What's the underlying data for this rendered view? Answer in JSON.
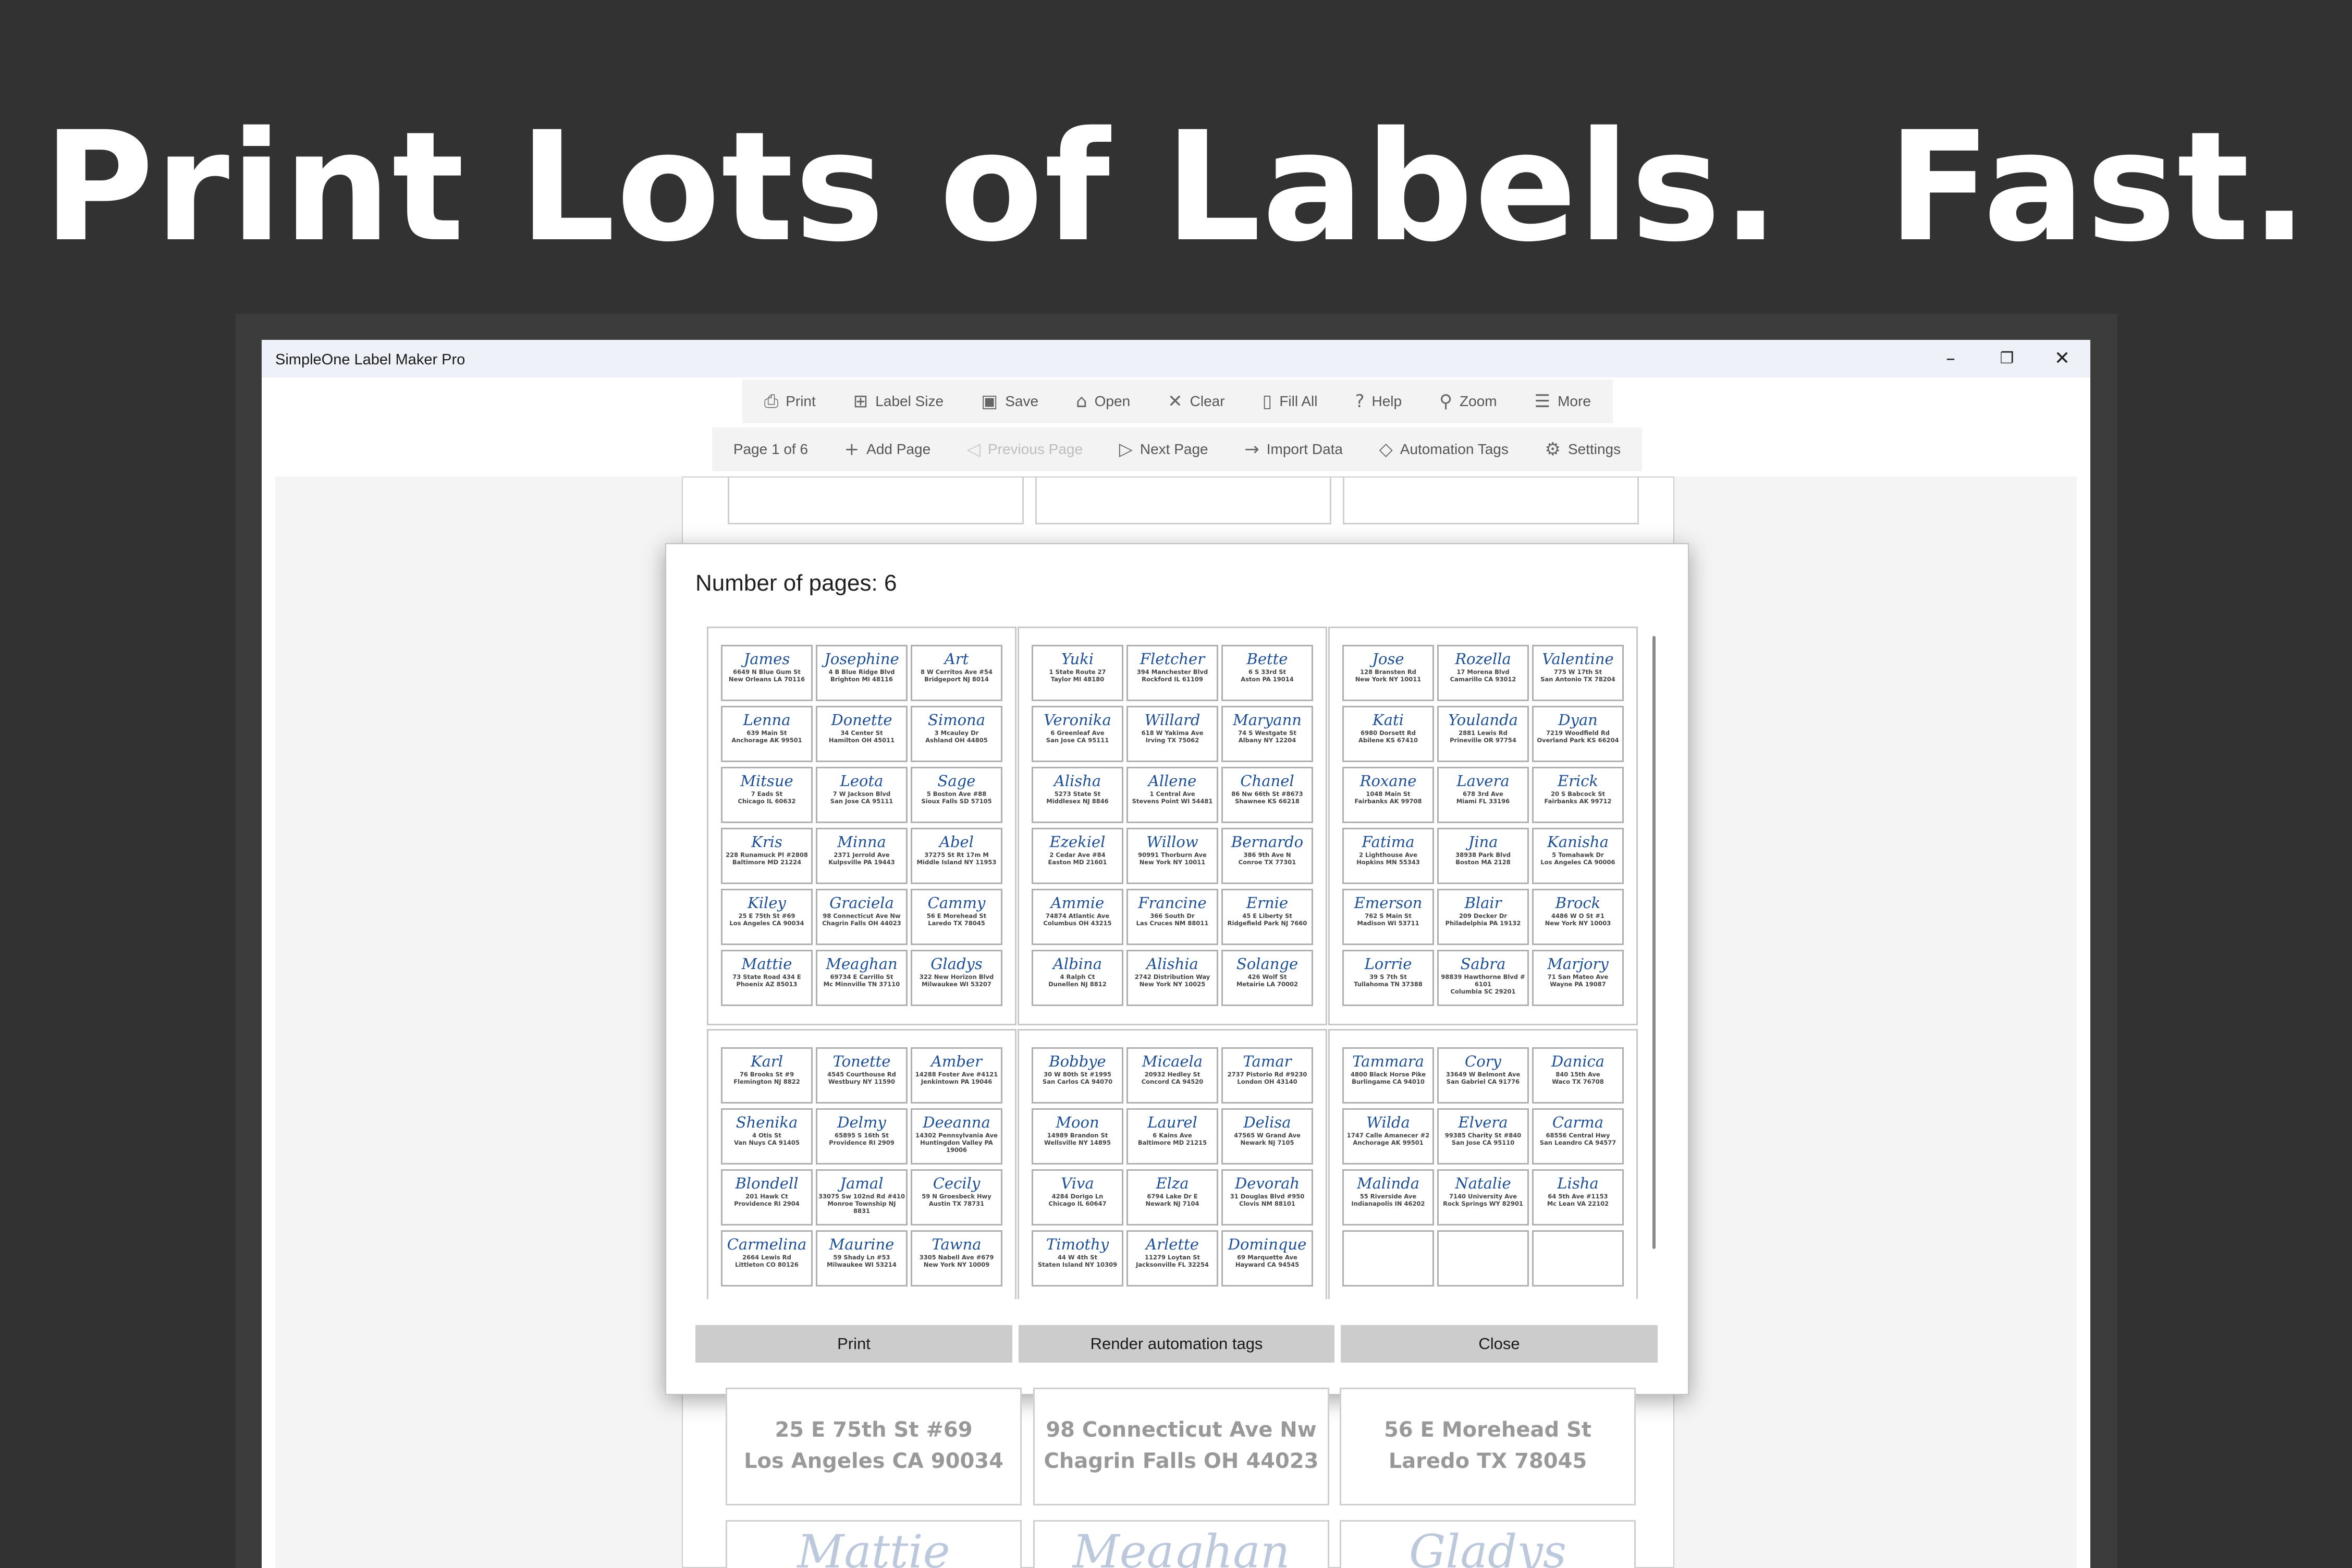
{
  "headline": "Print Lots of Labels.  Fast.",
  "window": {
    "title": "SimpleOne Label Maker Pro",
    "minimize": "–",
    "restore": "❐",
    "close": "✕"
  },
  "toolbar_main": [
    {
      "name": "print",
      "label": "Print",
      "icon": "⎙"
    },
    {
      "name": "label-size",
      "label": "Label Size",
      "icon": "⊞"
    },
    {
      "name": "save",
      "label": "Save",
      "icon": "▣"
    },
    {
      "name": "open",
      "label": "Open",
      "icon": "⌂"
    },
    {
      "name": "clear",
      "label": "Clear",
      "icon": "✕"
    },
    {
      "name": "fill-all",
      "label": "Fill All",
      "icon": "▯"
    },
    {
      "name": "help",
      "label": "Help",
      "icon": "?"
    },
    {
      "name": "zoom",
      "label": "Zoom",
      "icon": "⚲"
    },
    {
      "name": "more",
      "label": "More",
      "icon": "☰"
    }
  ],
  "toolbar_page": [
    {
      "name": "page-indicator",
      "label": "Page 1 of 6",
      "icon": "",
      "disabled": false
    },
    {
      "name": "add-page",
      "label": "Add Page",
      "icon": "+",
      "disabled": false
    },
    {
      "name": "previous-page",
      "label": "Previous Page",
      "icon": "◁",
      "disabled": true
    },
    {
      "name": "next-page",
      "label": "Next Page",
      "icon": "▷",
      "disabled": false
    },
    {
      "name": "import-data",
      "label": "Import Data",
      "icon": "→",
      "disabled": false
    },
    {
      "name": "automation-tags",
      "label": "Automation Tags",
      "icon": "◇",
      "disabled": false
    },
    {
      "name": "settings",
      "label": "Settings",
      "icon": "⚙",
      "disabled": false
    }
  ],
  "background_labels": [
    {
      "line1": "25 E 75th St #69",
      "line2": "Los Angeles CA 90034",
      "name": "Mattie"
    },
    {
      "line1": "98 Connecticut Ave Nw",
      "line2": "Chagrin Falls OH 44023",
      "name": "Meaghan"
    },
    {
      "line1": "56 E Morehead St",
      "line2": "Laredo TX 78045",
      "name": "Gladys"
    }
  ],
  "dialog": {
    "title": "Number of pages: 6",
    "buttons": {
      "print": "Print",
      "render": "Render automation tags",
      "close": "Close"
    },
    "pages": [
      {
        "labels": [
          [
            "James",
            "6649 N Blue Gum St",
            "New Orleans LA 70116"
          ],
          [
            "Josephine",
            "4 B Blue Ridge Blvd",
            "Brighton MI 48116"
          ],
          [
            "Art",
            "8 W Cerritos Ave #54",
            "Bridgeport NJ 8014"
          ],
          [
            "Lenna",
            "639 Main St",
            "Anchorage AK 99501"
          ],
          [
            "Donette",
            "34 Center St",
            "Hamilton OH 45011"
          ],
          [
            "Simona",
            "3 Mcauley Dr",
            "Ashland OH 44805"
          ],
          [
            "Mitsue",
            "7 Eads St",
            "Chicago IL 60632"
          ],
          [
            "Leota",
            "7 W Jackson Blvd",
            "San Jose CA 95111"
          ],
          [
            "Sage",
            "5 Boston Ave #88",
            "Sioux Falls SD 57105"
          ],
          [
            "Kris",
            "228 Runamuck Pl #2808",
            "Baltimore MD 21224"
          ],
          [
            "Minna",
            "2371 Jerrold Ave",
            "Kulpsville PA 19443"
          ],
          [
            "Abel",
            "37275 St  Rt 17m M",
            "Middle Island NY 11953"
          ],
          [
            "Kiley",
            "25 E 75th St #69",
            "Los Angeles CA 90034"
          ],
          [
            "Graciela",
            "98 Connecticut Ave Nw",
            "Chagrin Falls OH 44023"
          ],
          [
            "Cammy",
            "56 E Morehead St",
            "Laredo TX 78045"
          ],
          [
            "Mattie",
            "73 State Road 434 E",
            "Phoenix AZ 85013"
          ],
          [
            "Meaghan",
            "69734 E Carrillo St",
            "Mc Minnville TN 37110"
          ],
          [
            "Gladys",
            "322 New Horizon Blvd",
            "Milwaukee WI 53207"
          ]
        ]
      },
      {
        "labels": [
          [
            "Yuki",
            "1 State Route 27",
            "Taylor MI 48180"
          ],
          [
            "Fletcher",
            "394 Manchester Blvd",
            "Rockford IL 61109"
          ],
          [
            "Bette",
            "6 S 33rd St",
            "Aston PA 19014"
          ],
          [
            "Veronika",
            "6 Greenleaf Ave",
            "San Jose CA 95111"
          ],
          [
            "Willard",
            "618 W Yakima Ave",
            "Irving TX 75062"
          ],
          [
            "Maryann",
            "74 S Westgate St",
            "Albany NY 12204"
          ],
          [
            "Alisha",
            "5273 State St",
            "Middlesex NJ 8846"
          ],
          [
            "Allene",
            "1 Central Ave",
            "Stevens Point WI 54481"
          ],
          [
            "Chanel",
            "86 Nw 66th St #8673",
            "Shawnee KS 66218"
          ],
          [
            "Ezekiel",
            "2 Cedar Ave #84",
            "Easton MD 21601"
          ],
          [
            "Willow",
            "90991 Thorburn Ave",
            "New York NY 10011"
          ],
          [
            "Bernardo",
            "386 9th Ave N",
            "Conroe TX 77301"
          ],
          [
            "Ammie",
            "74874 Atlantic Ave",
            "Columbus OH 43215"
          ],
          [
            "Francine",
            "366 South Dr",
            "Las Cruces NM 88011"
          ],
          [
            "Ernie",
            "45 E Liberty St",
            "Ridgefield Park NJ 7660"
          ],
          [
            "Albina",
            "4 Ralph Ct",
            "Dunellen NJ 8812"
          ],
          [
            "Alishia",
            "2742 Distribution Way",
            "New York NY 10025"
          ],
          [
            "Solange",
            "426 Wolf St",
            "Metairie LA 70002"
          ]
        ]
      },
      {
        "labels": [
          [
            "Jose",
            "128 Bransten Rd",
            "New York NY 10011"
          ],
          [
            "Rozella",
            "17 Morena Blvd",
            "Camarillo CA 93012"
          ],
          [
            "Valentine",
            "775 W 17th St",
            "San Antonio TX 78204"
          ],
          [
            "Kati",
            "6980 Dorsett Rd",
            "Abilene KS 67410"
          ],
          [
            "Youlanda",
            "2881 Lewis Rd",
            "Prineville OR 97754"
          ],
          [
            "Dyan",
            "7219 Woodfield Rd",
            "Overland Park KS 66204"
          ],
          [
            "Roxane",
            "1048 Main St",
            "Fairbanks AK 99708"
          ],
          [
            "Lavera",
            "678 3rd Ave",
            "Miami FL 33196"
          ],
          [
            "Erick",
            "20 S Babcock St",
            "Fairbanks AK 99712"
          ],
          [
            "Fatima",
            "2 Lighthouse Ave",
            "Hopkins MN 55343"
          ],
          [
            "Jina",
            "38938 Park Blvd",
            "Boston MA 2128"
          ],
          [
            "Kanisha",
            "5 Tomahawk Dr",
            "Los Angeles CA 90006"
          ],
          [
            "Emerson",
            "762 S Main St",
            "Madison WI 53711"
          ],
          [
            "Blair",
            "209 Decker Dr",
            "Philadelphia PA 19132"
          ],
          [
            "Brock",
            "4486 W O St #1",
            "New York NY 10003"
          ],
          [
            "Lorrie",
            "39 S 7th St",
            "Tullahoma TN 37388"
          ],
          [
            "Sabra",
            "98839 Hawthorne Blvd #",
            "6101",
            "Columbia SC 29201"
          ],
          [
            "Marjory",
            "71 San Mateo Ave",
            "Wayne PA 19087"
          ]
        ]
      },
      {
        "labels": [
          [
            "Karl",
            "76 Brooks St #9",
            "Flemington NJ 8822"
          ],
          [
            "Tonette",
            "4545 Courthouse Rd",
            "Westbury NY 11590"
          ],
          [
            "Amber",
            "14288 Foster Ave #4121",
            "Jenkintown PA 19046"
          ],
          [
            "Shenika",
            "4 Otis St",
            "Van Nuys CA 91405"
          ],
          [
            "Delmy",
            "65895 S 16th St",
            "Providence RI 2909"
          ],
          [
            "Deeanna",
            "14302 Pennsylvania Ave",
            "Huntingdon Valley PA",
            "19006"
          ],
          [
            "Blondell",
            "201 Hawk Ct",
            "Providence RI 2904"
          ],
          [
            "Jamal",
            "33075 Sw 102nd Rd #410",
            "Monroe Township NJ",
            "8831"
          ],
          [
            "Cecily",
            "59 N Groesbeck Hwy",
            "Austin TX 78731"
          ],
          [
            "Carmelina",
            "2664 Lewis Rd",
            "Littleton CO 80126"
          ],
          [
            "Maurine",
            "59 Shady Ln #53",
            "Milwaukee WI 53214"
          ],
          [
            "Tawna",
            "3305 Nabell Ave #679",
            "New York NY 10009"
          ]
        ]
      },
      {
        "labels": [
          [
            "Bobbye",
            "30 W 80th St #1995",
            "San Carlos CA 94070"
          ],
          [
            "Micaela",
            "20932 Hedley St",
            "Concord CA 94520"
          ],
          [
            "Tamar",
            "2737 Pistorio Rd #9230",
            "London OH 43140"
          ],
          [
            "Moon",
            "14989 Brandon St",
            "Wellsville NY 14895"
          ],
          [
            "Laurel",
            "6 Kains Ave",
            "Baltimore MD 21215"
          ],
          [
            "Delisa",
            "47565 W Grand Ave",
            "Newark NJ 7105"
          ],
          [
            "Viva",
            "4284 Dorigo Ln",
            "Chicago IL 60647"
          ],
          [
            "Elza",
            "6794 Lake Dr E",
            "Newark NJ 7104"
          ],
          [
            "Devorah",
            "31 Douglas Blvd #950",
            "Clovis NM 88101"
          ],
          [
            "Timothy",
            "44 W 4th St",
            "Staten Island NY 10309"
          ],
          [
            "Arlette",
            "11279 Loytan St",
            "Jacksonville FL 32254"
          ],
          [
            "Dominque",
            "69 Marquette Ave",
            "Hayward CA 94545"
          ]
        ]
      },
      {
        "labels": [
          [
            "Tammara",
            "4800 Black Horse Pike",
            "Burlingame CA 94010"
          ],
          [
            "Cory",
            "33649 W Belmont Ave",
            "San Gabriel CA 91776"
          ],
          [
            "Danica",
            "840 15th Ave",
            "Waco TX 76708"
          ],
          [
            "Wilda",
            "1747 Calle Amanecer #2",
            "Anchorage AK 99501"
          ],
          [
            "Elvera",
            "99385 Charity St #840",
            "San Jose CA 95110"
          ],
          [
            "Carma",
            "68556 Central Hwy",
            "San Leandro CA 94577"
          ],
          [
            "Malinda",
            "55 Riverside Ave",
            "Indianapolis IN 46202"
          ],
          [
            "Natalie",
            "7140 University Ave",
            "Rock Springs WY 82901"
          ],
          [
            "Lisha",
            "64 5th Ave #1153",
            "Mc Lean VA 22102"
          ],
          [
            "",
            "",
            ""
          ],
          [
            "",
            "",
            ""
          ],
          [
            "",
            "",
            ""
          ]
        ]
      }
    ]
  }
}
